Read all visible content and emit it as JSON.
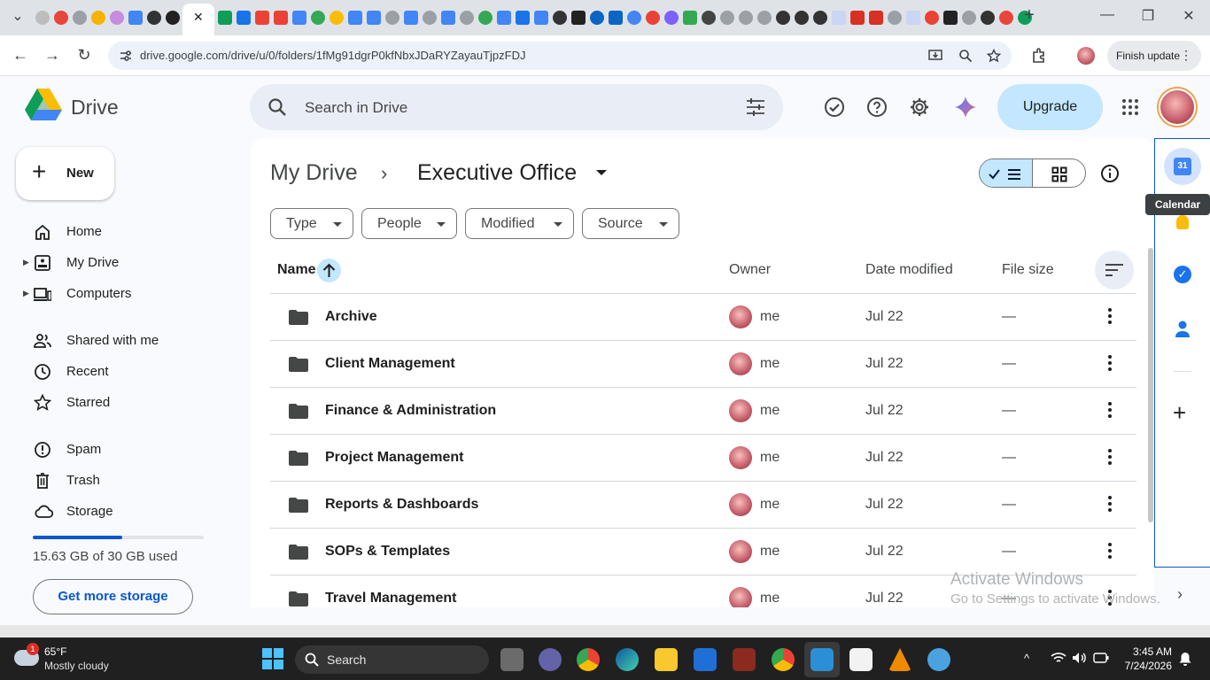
{
  "browser": {
    "url": "drive.google.com/drive/u/0/folders/1fMg91dgrP0kfNbxJDaRYZayauTjpzFDJ",
    "finish_update_label": "Finish update"
  },
  "header": {
    "app_name": "Drive",
    "search_placeholder": "Search in Drive",
    "upgrade_label": "Upgrade"
  },
  "sidebar": {
    "new_label": "New",
    "items": [
      {
        "label": "Home",
        "icon": "home-icon"
      },
      {
        "label": "My Drive",
        "icon": "my-drive-icon"
      },
      {
        "label": "Computers",
        "icon": "computers-icon"
      },
      {
        "label": "Shared with me",
        "icon": "shared-icon"
      },
      {
        "label": "Recent",
        "icon": "clock-icon"
      },
      {
        "label": "Starred",
        "icon": "star-icon"
      },
      {
        "label": "Spam",
        "icon": "spam-icon"
      },
      {
        "label": "Trash",
        "icon": "trash-icon"
      },
      {
        "label": "Storage",
        "icon": "cloud-icon"
      }
    ],
    "storage_used_fraction": 0.521,
    "storage_text": "15.63 GB of 30 GB used",
    "get_storage_label": "Get more storage"
  },
  "main": {
    "breadcrumb_root": "My Drive",
    "breadcrumb_current": "Executive Office",
    "filters": [
      "Type",
      "People",
      "Modified",
      "Source"
    ],
    "columns": {
      "name": "Name",
      "owner": "Owner",
      "date": "Date modified",
      "size": "File size"
    },
    "rows": [
      {
        "name": "Archive",
        "owner": "me",
        "date": "Jul 22",
        "size": "—"
      },
      {
        "name": "Client Management",
        "owner": "me",
        "date": "Jul 22",
        "size": "—"
      },
      {
        "name": "Finance & Administration",
        "owner": "me",
        "date": "Jul 22",
        "size": "—"
      },
      {
        "name": "Project Management",
        "owner": "me",
        "date": "Jul 22",
        "size": "—"
      },
      {
        "name": "Reports & Dashboards",
        "owner": "me",
        "date": "Jul 22",
        "size": "—"
      },
      {
        "name": "SOPs & Templates",
        "owner": "me",
        "date": "Jul 22",
        "size": "—"
      },
      {
        "name": "Travel Management",
        "owner": "me",
        "date": "Jul 22",
        "size": "—"
      }
    ]
  },
  "side_panel": {
    "tooltip": "Calendar",
    "calendar_day": "31"
  },
  "watermark": {
    "line1": "Activate Windows",
    "line2": "Go to Settings to activate Windows."
  },
  "taskbar": {
    "weather_temp": "65°F",
    "weather_desc": "Mostly cloudy",
    "weather_badge": "1",
    "search_label": "Search",
    "time": "3:45 AM",
    "date": "7/24/2026"
  },
  "colors": {
    "accent": "#0b57d0",
    "selected": "#c2e7ff",
    "surface": "#f8fafd"
  }
}
